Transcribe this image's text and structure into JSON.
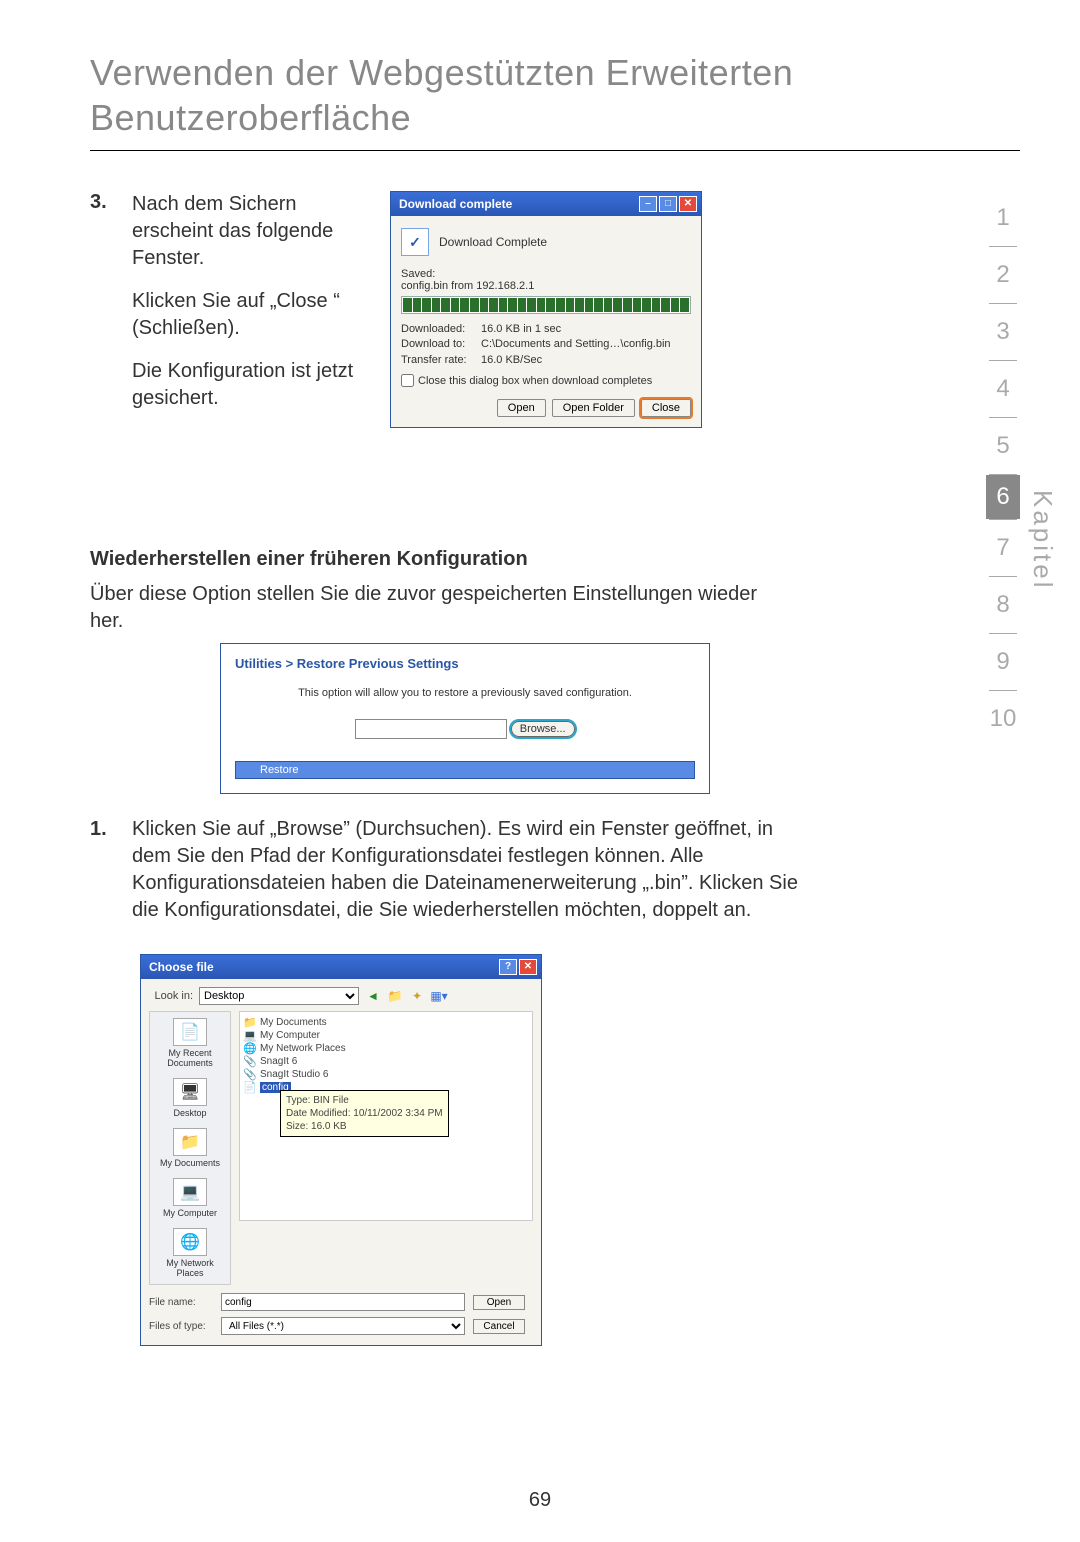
{
  "page": {
    "title_line1": "Verwenden der Webgestützten Erweiterten",
    "title_line2": "Benutzeroberfläche",
    "pagenum": "69",
    "kapitel_label": "Kapitel"
  },
  "step3": {
    "num": "3.",
    "p1": "Nach dem Sichern erscheint das folgende Fenster.",
    "p2": "Klicken Sie auf „Close “ (Schließen).",
    "p3": "Die Konfiguration ist jetzt gesichert."
  },
  "dl": {
    "title": "Download complete",
    "icon_text": "✓",
    "complete": "Download Complete",
    "saved_label": "Saved:",
    "file": "config.bin from 192.168.2.1",
    "r1k": "Downloaded:",
    "r1v": "16.0 KB in 1 sec",
    "r2k": "Download to:",
    "r2v": "C:\\Documents and Setting…\\config.bin",
    "r3k": "Transfer rate:",
    "r3v": "16.0 KB/Sec",
    "chk": "Close this dialog box when download completes",
    "open": "Open",
    "open_folder": "Open Folder",
    "close": "Close"
  },
  "restore": {
    "heading": "Wiederherstellen einer früheren Konfiguration",
    "intro": "Über diese Option stellen Sie die zuvor gespeicherten Einstellungen wieder her.",
    "crumb": "Utilities > Restore Previous Settings",
    "desc": "This option will allow you to restore a previously saved configuration.",
    "browse": "Browse...",
    "restore": "Restore"
  },
  "step1": {
    "num": "1.",
    "text": "Klicken Sie auf „Browse” (Durchsuchen). Es wird ein Fenster geöffnet, in dem Sie den Pfad der Konfigurationsdatei festlegen können. Alle Konfigurationsdateien haben die Dateinamenerweiterung „.bin”. Klicken Sie die Konfigurationsdatei, die Sie wiederherstellen möchten, doppelt an."
  },
  "fc": {
    "title": "Choose file",
    "lookin_label": "Look in:",
    "lookin_value": "Desktop",
    "places": {
      "recent": "My Recent Documents",
      "desktop": "Desktop",
      "mydocs": "My Documents",
      "mycomp": "My Computer",
      "mynet": "My Network Places"
    },
    "items": {
      "mydocs": "My Documents",
      "mycomp": "My Computer",
      "mynet": "My Network Places",
      "snag": "SnagIt 6",
      "snagst": "SnagIt Studio 6",
      "config": "config"
    },
    "tooltip": {
      "l1": "Type: BIN File",
      "l2": "Date Modified: 10/11/2002 3:34 PM",
      "l3": "Size: 16.0 KB"
    },
    "fname_label": "File name:",
    "fname_value": "config",
    "ftype_label": "Files of type:",
    "ftype_value": "All Files (*.*)",
    "open": "Open",
    "cancel": "Cancel"
  },
  "chapters": [
    "1",
    "2",
    "3",
    "4",
    "5",
    "6",
    "7",
    "8",
    "9",
    "10"
  ],
  "active_chapter": "6"
}
